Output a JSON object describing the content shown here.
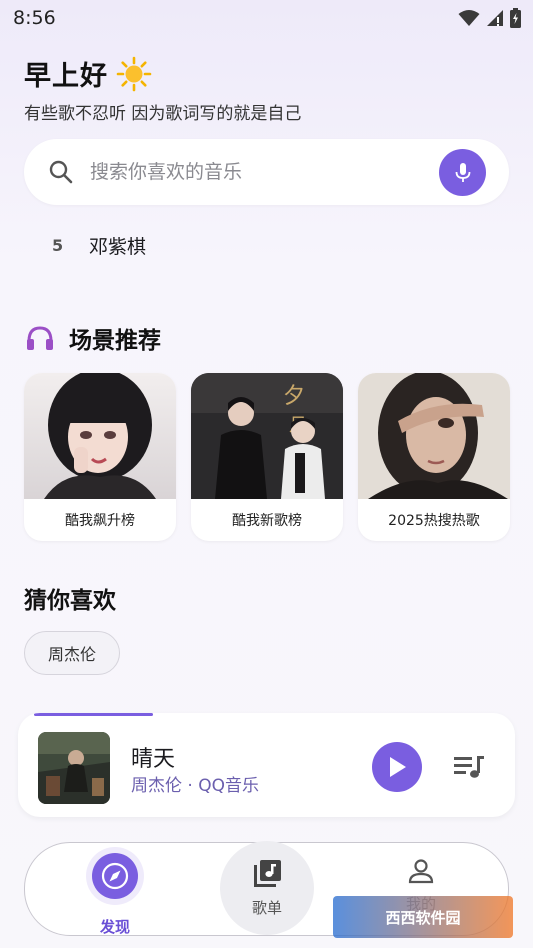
{
  "status_bar": {
    "time": "8:56"
  },
  "header": {
    "greeting": "早上好",
    "greeting_icon": "sun-icon",
    "subtitle": "有些歌不忍听 因为歌词写的就是自己"
  },
  "search": {
    "placeholder": "搜索你喜欢的音乐",
    "value": "",
    "search_icon": "search-icon",
    "voice_icon": "mic-icon"
  },
  "hot_search": [
    {
      "rank": "5",
      "label": "邓紫棋"
    }
  ],
  "scene_section": {
    "title": "场景推荐",
    "icon": "headphones-icon",
    "cards": [
      {
        "label": "酷我飙升榜"
      },
      {
        "label": "酷我新歌榜"
      },
      {
        "label": "2025热搜热歌"
      }
    ]
  },
  "guess_section": {
    "title": "猜你喜欢",
    "chips": [
      "周杰伦"
    ]
  },
  "player": {
    "title": "晴天",
    "meta": "周杰伦 · QQ音乐",
    "progress": 0.24
  },
  "bottom_nav": {
    "items": [
      {
        "label": "发现",
        "icon": "compass-icon",
        "active": true
      },
      {
        "label": "歌单",
        "icon": "music-library-icon",
        "active": false
      },
      {
        "label": "我的",
        "icon": "person-icon",
        "active": false
      }
    ]
  },
  "watermark": {
    "text": "西西软件园"
  },
  "colors": {
    "accent": "#7a5ee0",
    "background": "#f6f4fb",
    "card": "#ffffff"
  }
}
